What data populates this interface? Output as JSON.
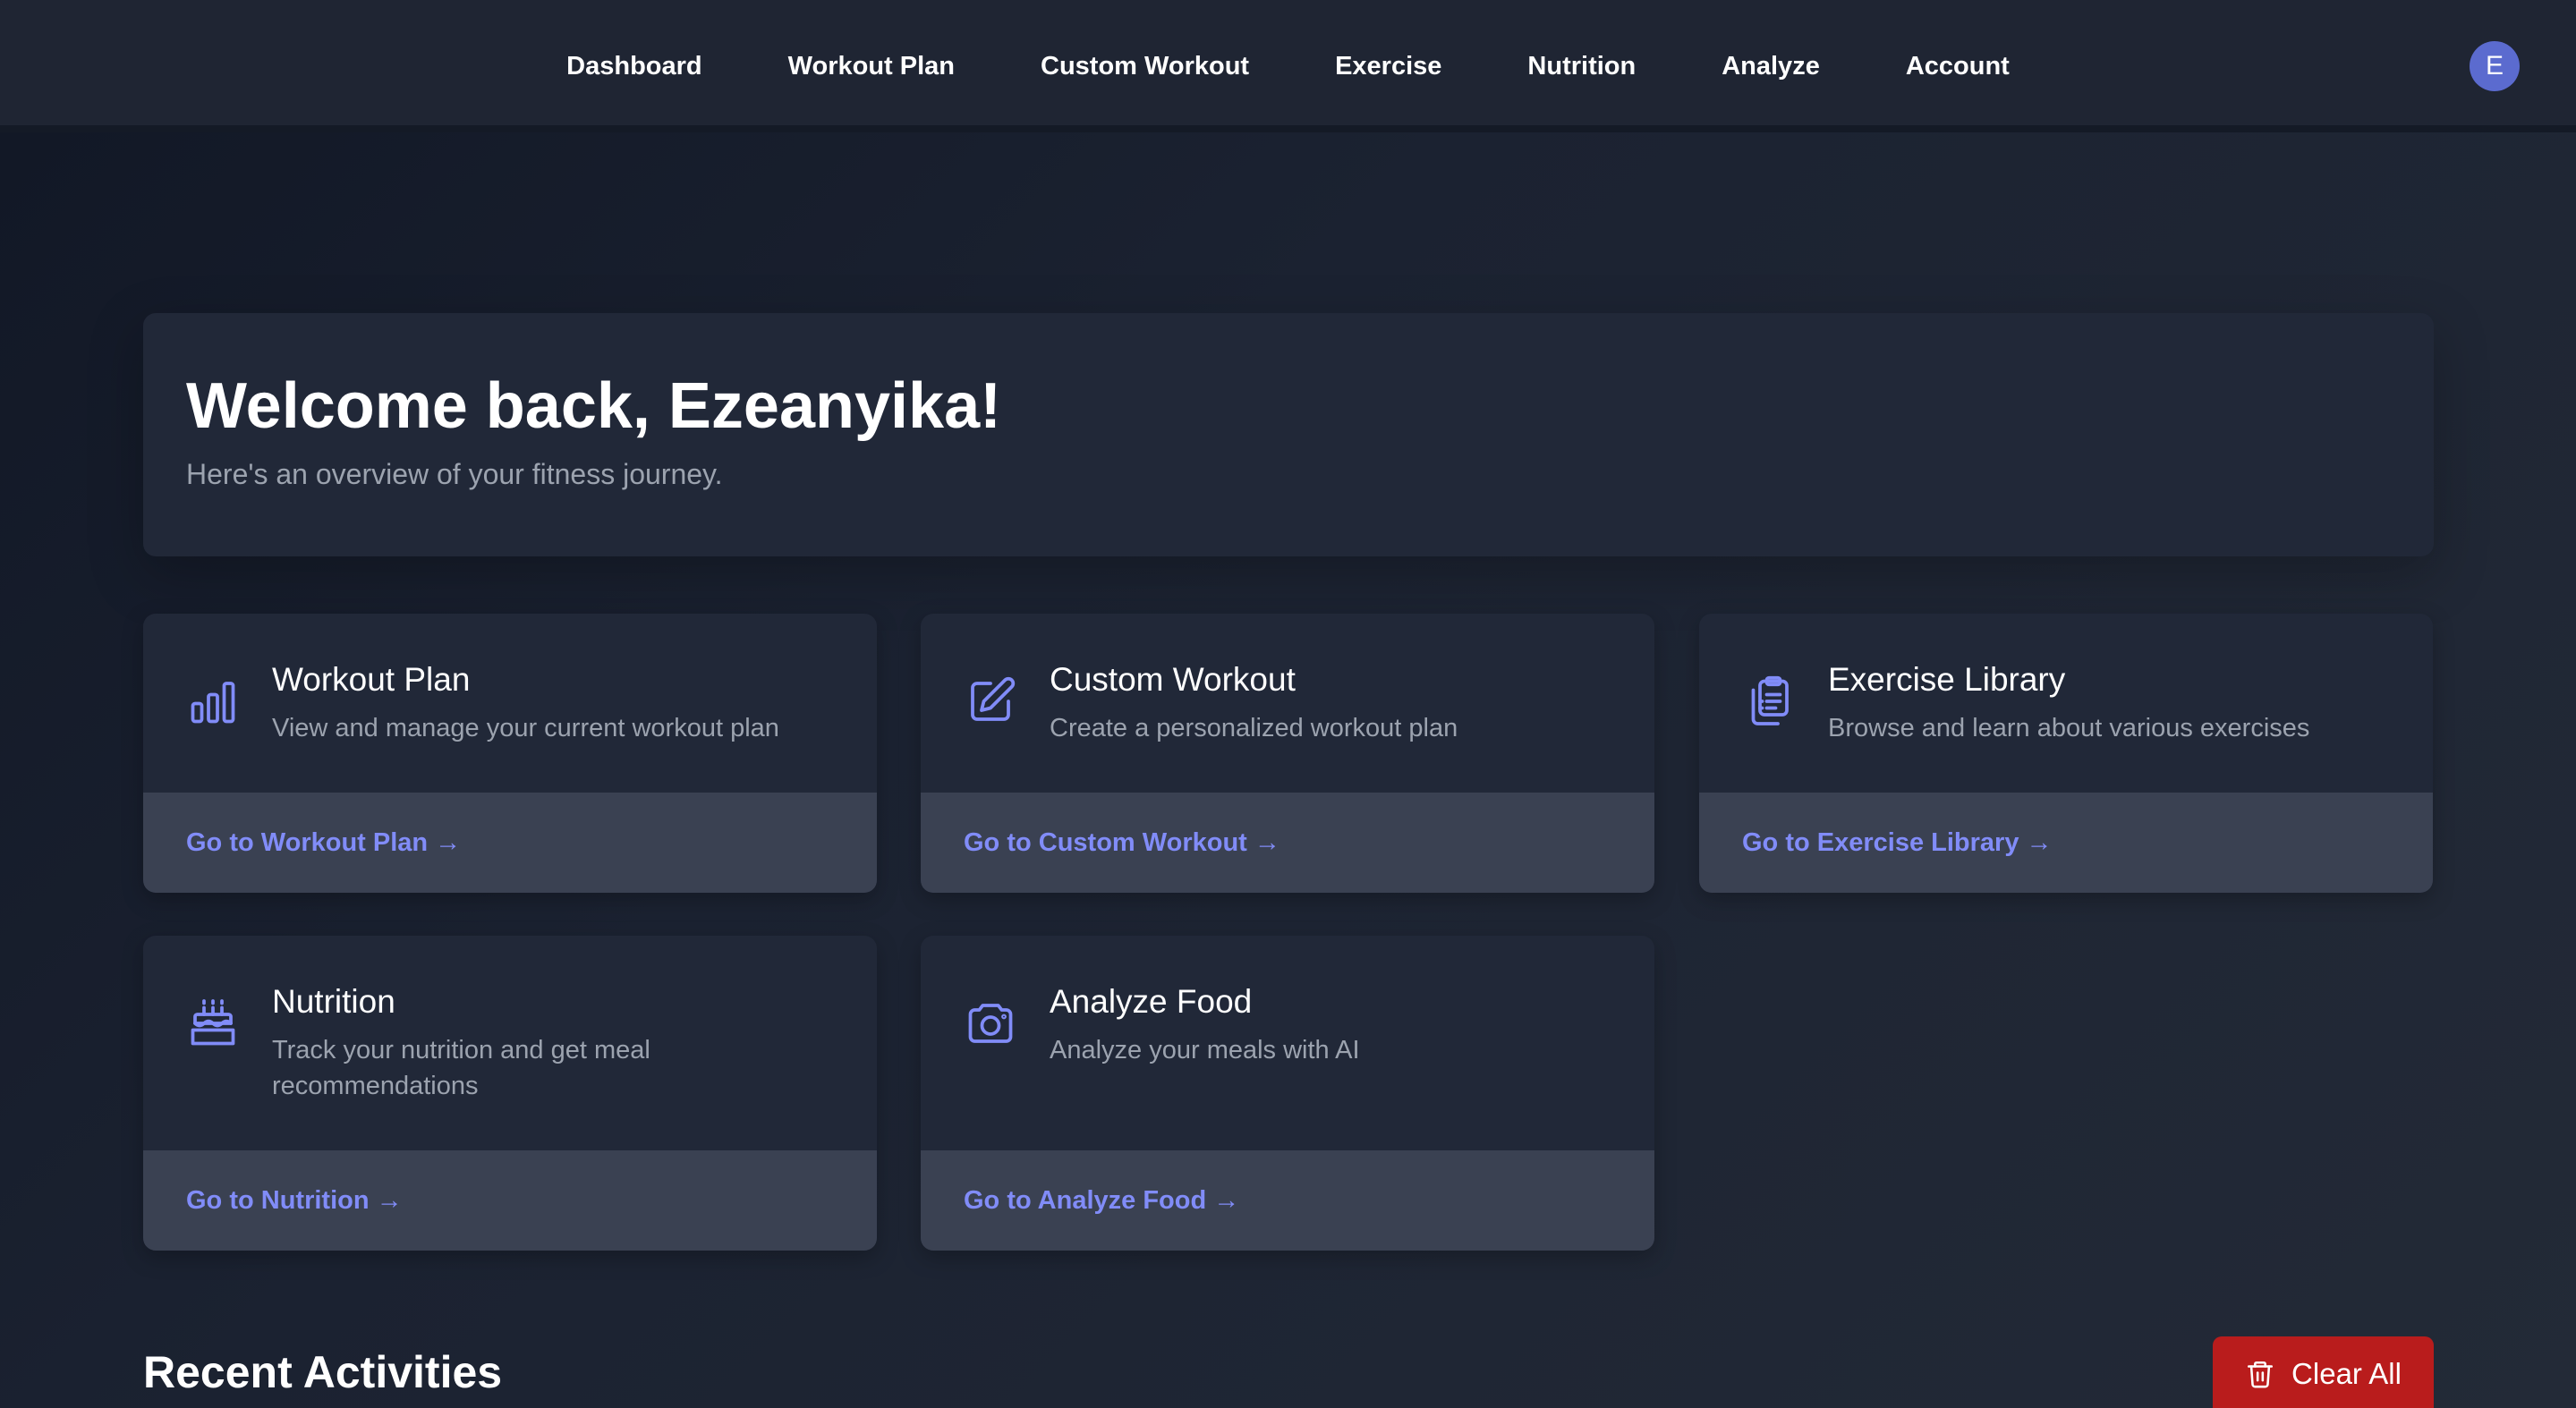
{
  "nav": {
    "links": [
      "Dashboard",
      "Workout Plan",
      "Custom Workout",
      "Exercise",
      "Nutrition",
      "Analyze",
      "Account"
    ],
    "avatar_initial": "E"
  },
  "welcome": {
    "title": "Welcome back, Ezeanyika!",
    "subtitle": "Here's an overview of your fitness journey."
  },
  "cards": [
    {
      "title": "Workout Plan",
      "description": "View and manage your current workout plan",
      "link": "Go to Workout Plan →",
      "icon": "bar-chart-icon"
    },
    {
      "title": "Custom Workout",
      "description": "Create a personalized workout plan",
      "link": "Go to Custom Workout →",
      "icon": "pencil-icon"
    },
    {
      "title": "Exercise Library",
      "description": "Browse and learn about various exercises",
      "link": "Go to Exercise Library →",
      "icon": "clipboard-icon"
    },
    {
      "title": "Nutrition",
      "description": "Track your nutrition and get meal recommendations",
      "link": "Go to Nutrition →",
      "icon": "cake-icon"
    },
    {
      "title": "Analyze Food",
      "description": "Analyze your meals with AI",
      "link": "Go to Analyze Food →",
      "icon": "camera-icon"
    }
  ],
  "activities": {
    "title": "Recent Activities",
    "clear_label": "Clear All",
    "clear_icon": "trash-icon"
  },
  "colors": {
    "accent": "#818cf8",
    "avatar": "#5b6bcf",
    "danger": "#b91c1c",
    "card_bg": "#212838",
    "card_footer_bg": "#3a4152"
  }
}
